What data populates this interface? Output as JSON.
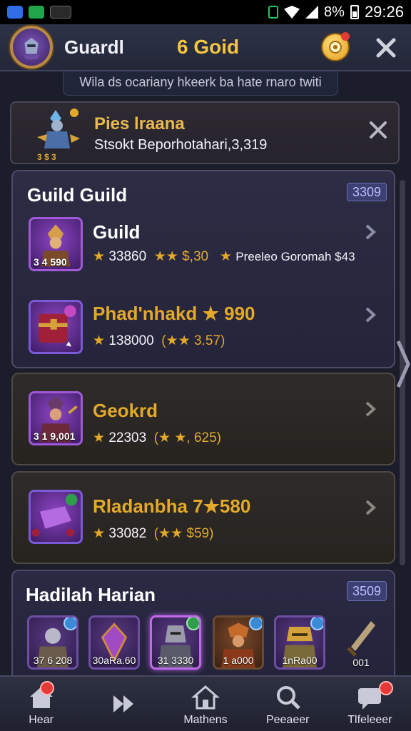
{
  "status_bar": {
    "time": "29:26",
    "battery": "8%"
  },
  "header": {
    "name": "Guardl",
    "gold": "6 Goid"
  },
  "subbar": {
    "text": "Wila ds ocariany hkeerk ba hate rnaro twiti"
  },
  "notification": {
    "title": "Pies lraana",
    "subtitle": "Stsokt Beporhotahari,3,319",
    "hero_caption": "3 $ 3"
  },
  "guild_panel": {
    "title": "Guild Guild",
    "badge": "3309",
    "rows": [
      {
        "title": "Guild",
        "title_color": "#ffffff",
        "thumb_caption": "3 4 590",
        "stats": {
          "a": "33860",
          "b": "$,30",
          "c": "Preeleo Goromah $43"
        }
      },
      {
        "title": "Phad'nhakd",
        "title_color": "#e3a92a",
        "title_suffix": "990",
        "stats": {
          "a": "138000",
          "b": "3.57)"
        }
      }
    ]
  },
  "cards": [
    {
      "title": "Geokrd",
      "thumb_caption": "3 1 9,001",
      "stats": {
        "a": "22303",
        "b": "625)"
      }
    },
    {
      "title": "Rladanbha 7",
      "title_suffix": "580",
      "stats": {
        "a": "33082",
        "b": "$59)"
      }
    }
  ],
  "daily": {
    "title": "Hadilah Harian",
    "badge": "3509",
    "items": [
      {
        "caption": "37 6 208",
        "plus": "blue"
      },
      {
        "caption": "30aRa.60",
        "plus": "none"
      },
      {
        "caption": "31 3330",
        "plus": "green"
      },
      {
        "caption": "1 a000",
        "plus": "blue"
      },
      {
        "caption": "1nRa00",
        "plus": "blue"
      },
      {
        "caption": "001",
        "plus": "none"
      }
    ]
  },
  "bottom_nav": [
    {
      "label": "Hear",
      "icon": "home-icon",
      "badge": true
    },
    {
      "label": "",
      "icon": "fast-forward-icon",
      "badge": false
    },
    {
      "label": "Mathens",
      "icon": "house-icon",
      "badge": false
    },
    {
      "label": "Peeaeer",
      "icon": "search-icon",
      "badge": false
    },
    {
      "label": "Tlfeleeer",
      "icon": "chat-icon",
      "badge": true
    }
  ],
  "colors": {
    "accent_gold": "#e3a92a",
    "badge_red": "#e53935",
    "panel_purple": "#2c2c44",
    "card_brown": "#2f2b2a"
  }
}
